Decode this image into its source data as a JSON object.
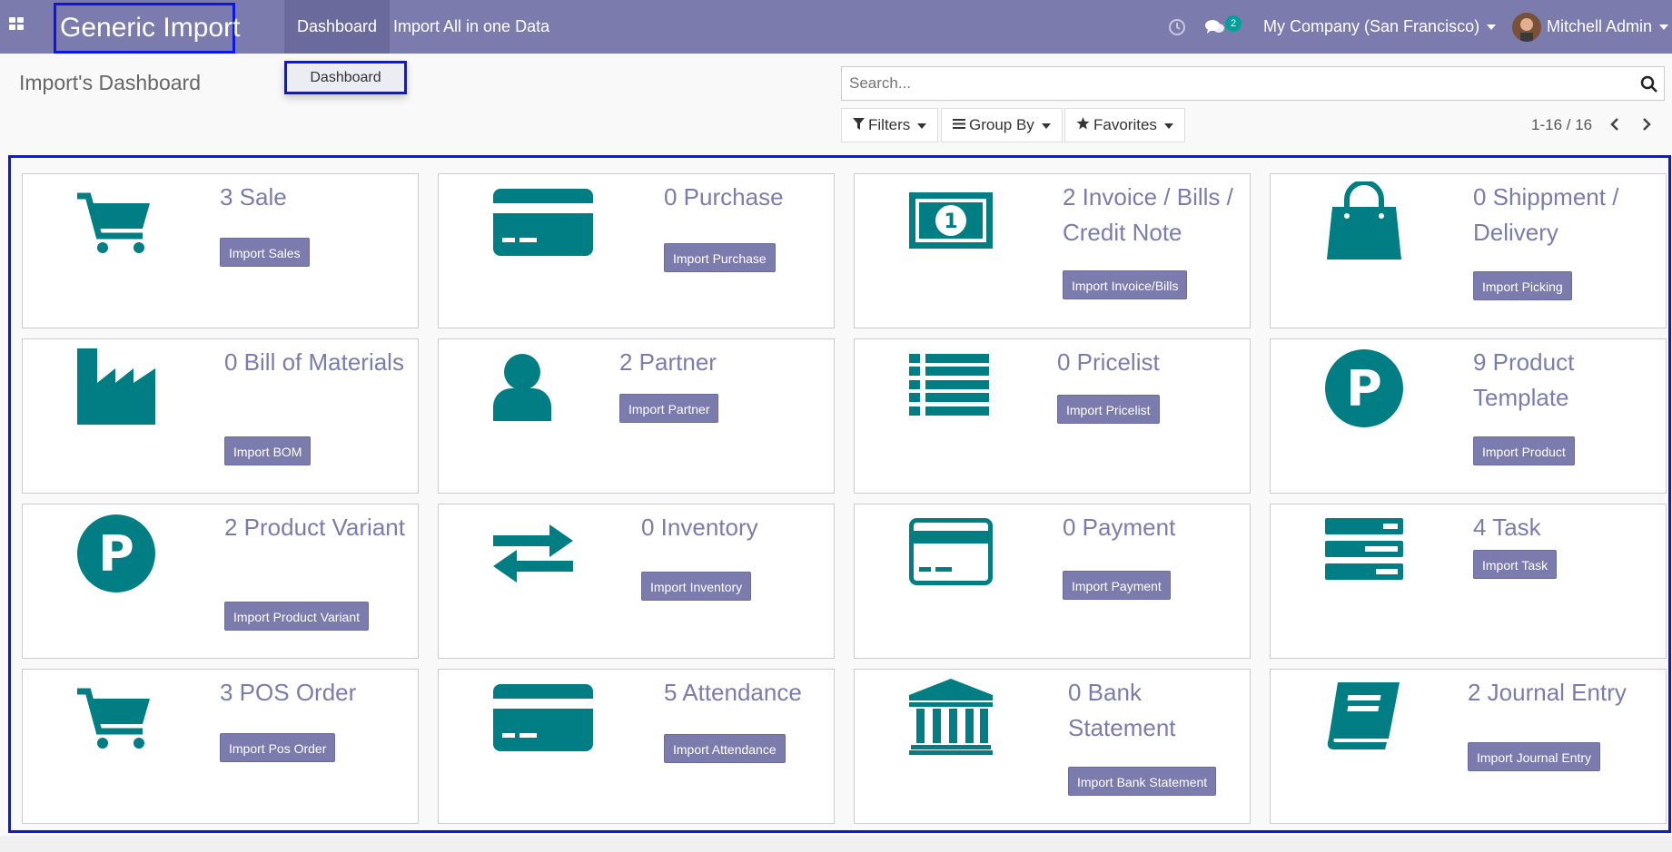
{
  "navbar": {
    "brand": "Generic Import",
    "menu": [
      "Dashboard",
      "Import All in one Data"
    ],
    "messages_count": "2",
    "company": "My Company (San Francisco)",
    "user": "Mitchell Admin",
    "color": "#7c7bad"
  },
  "dropdown": {
    "item": "Dashboard"
  },
  "control_panel": {
    "title": "Import's Dashboard",
    "search_placeholder": "Search...",
    "filters": "Filters",
    "group_by": "Group By",
    "favorites": "Favorites",
    "pager": "1-16 / 16"
  },
  "cards": [
    {
      "title": "3 Sale",
      "button": "Import Sales",
      "icon": "shopping-cart-icon"
    },
    {
      "title": "0 Purchase",
      "button": "Import Purchase",
      "icon": "credit-card-icon"
    },
    {
      "title": "2 Invoice / Bills / Credit Note",
      "button": "Import Invoice/Bills",
      "icon": "money-bill-icon"
    },
    {
      "title": "0 Shippment / Delivery",
      "button": "Import Picking",
      "icon": "shopping-bag-icon"
    },
    {
      "title": "0 Bill of Materials",
      "button": "Import BOM",
      "icon": "industry-icon"
    },
    {
      "title": "2 Partner",
      "button": "Import Partner",
      "icon": "user-icon"
    },
    {
      "title": "0 Pricelist",
      "button": "Import Pricelist",
      "icon": "list-icon"
    },
    {
      "title": "9 Product Template",
      "button": "Import Product",
      "icon": "product-p-icon"
    },
    {
      "title": "2 Product Variant",
      "button": "Import Product Variant",
      "icon": "product-p-icon"
    },
    {
      "title": "0 Inventory",
      "button": "Import Inventory",
      "icon": "exchange-arrows-icon"
    },
    {
      "title": "0 Payment",
      "button": "Import Payment",
      "icon": "payment-card-icon"
    },
    {
      "title": "4 Task",
      "button": "Import Task",
      "icon": "tasks-icon"
    },
    {
      "title": "3 POS Order",
      "button": "Import Pos Order",
      "icon": "shopping-cart-icon"
    },
    {
      "title": "5 Attendance",
      "button": "Import Attendance",
      "icon": "credit-card-icon"
    },
    {
      "title": "0 Bank Statement",
      "button": "Import Bank Statement",
      "icon": "bank-icon"
    },
    {
      "title": "2 Journal Entry",
      "button": "Import Journal Entry",
      "icon": "book-icon"
    }
  ],
  "colors": {
    "icon": "#017e84",
    "accent": "#7c7bad",
    "highlight": "#0a17e6"
  }
}
